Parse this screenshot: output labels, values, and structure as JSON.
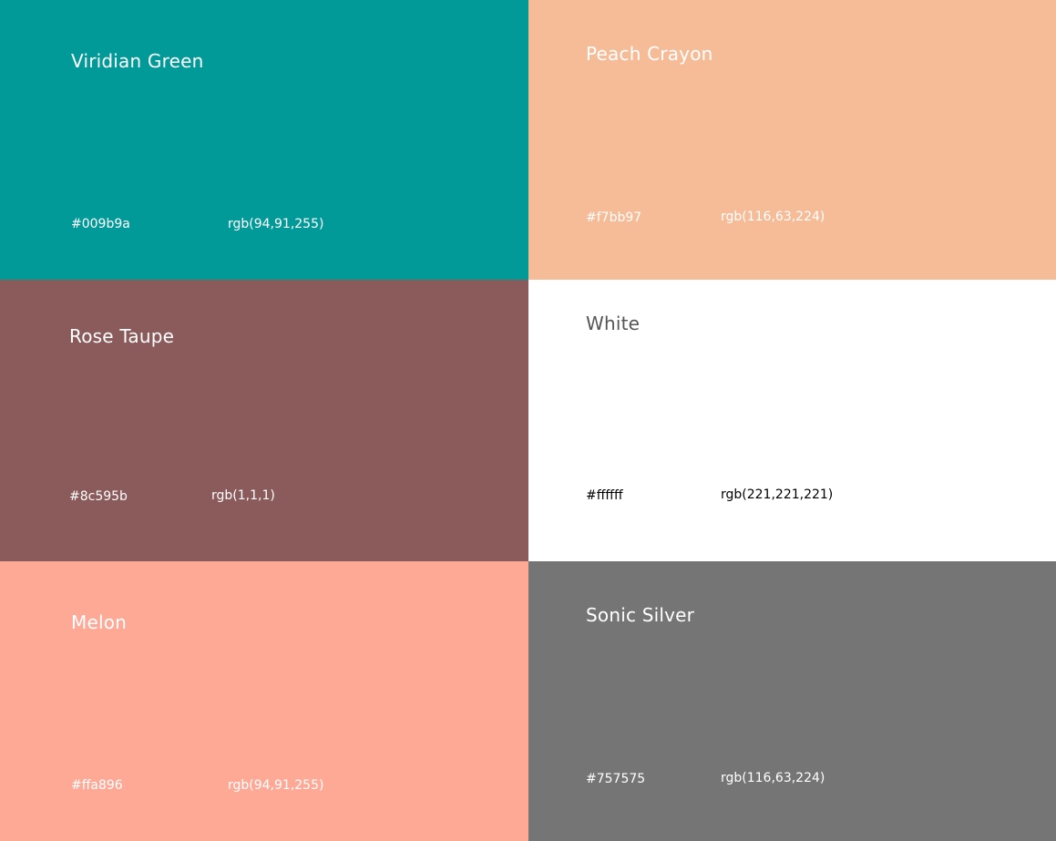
{
  "swatches": [
    {
      "name": "Viridian Green",
      "hex": "#009b9a",
      "rgb": "rgb(94,91,255)",
      "background": "#029a99",
      "text_color": "#ffffff"
    },
    {
      "name": "Peach Crayon",
      "hex": "#f7bb97",
      "rgb": "rgb(116,63,224)",
      "background": "#f6bb97",
      "text_color": "#ffffff"
    },
    {
      "name": "Rose Taupe",
      "hex": "#8c595b",
      "rgb": "rgb(1,1,1)",
      "background": "#8b5a5b",
      "text_color": "#ffffff"
    },
    {
      "name": "White",
      "hex": "#ffffff",
      "rgb": "rgb(221,221,221)",
      "background": "#ffffff",
      "text_color": "#555555",
      "code_color": "#000000"
    },
    {
      "name": "Melon",
      "hex": "#ffa896",
      "rgb": "rgb(94,91,255)",
      "background": "#fea896",
      "text_color": "#ffffff"
    },
    {
      "name": "Sonic Silver",
      "hex": "#757575",
      "rgb": "rgb(116,63,224)",
      "background": "#757575",
      "text_color": "#ffffff"
    }
  ]
}
